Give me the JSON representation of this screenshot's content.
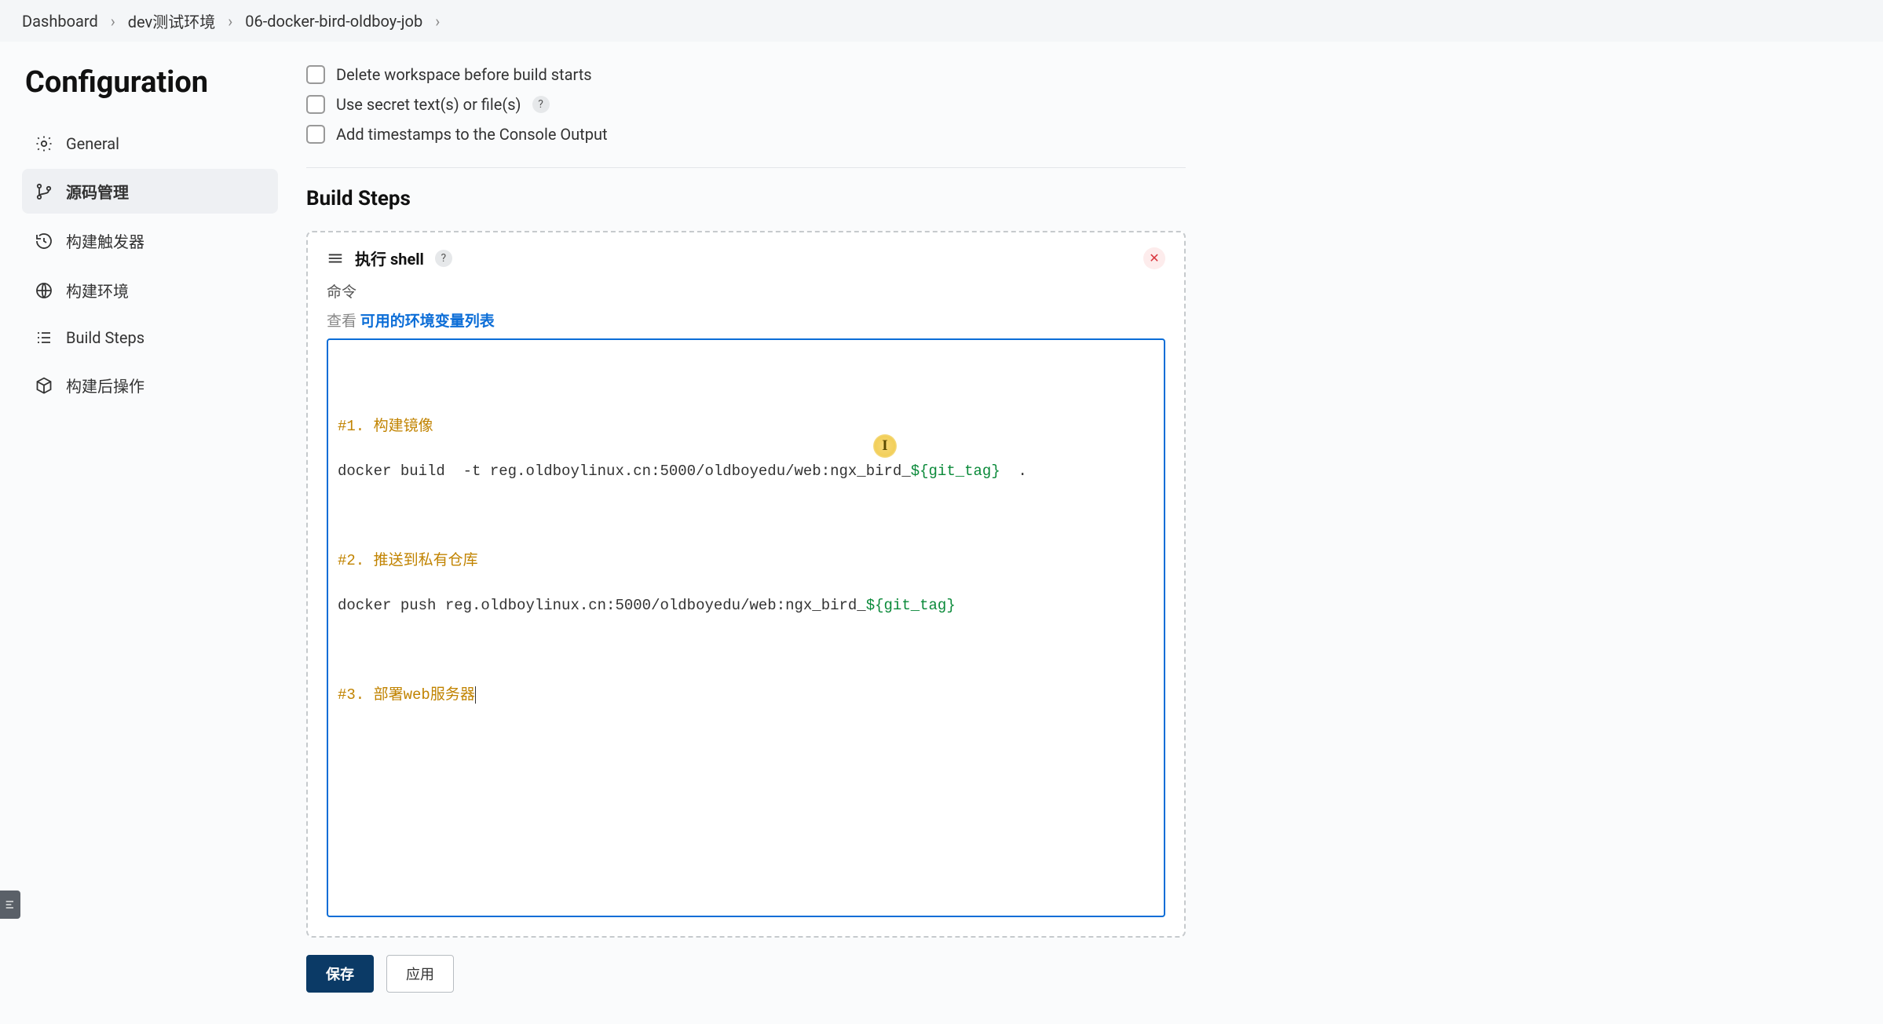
{
  "breadcrumb": {
    "items": [
      "Dashboard",
      "dev测试环境",
      "06-docker-bird-oldboy-job"
    ]
  },
  "sidebar": {
    "title": "Configuration",
    "items": [
      {
        "label": "General"
      },
      {
        "label": "源码管理"
      },
      {
        "label": "构建触发器"
      },
      {
        "label": "构建环境"
      },
      {
        "label": "Build Steps"
      },
      {
        "label": "构建后操作"
      }
    ],
    "active_index": 1
  },
  "main": {
    "checkboxes": {
      "delete_workspace": "Delete workspace before build starts",
      "use_secret": "Use secret text(s) or file(s)",
      "add_timestamps": "Add timestamps to the Console Output"
    },
    "build_steps_title": "Build Steps",
    "step": {
      "title": "执行 shell",
      "command_label": "命令",
      "hint_prefix": "查看 ",
      "hint_link": "可用的环境变量列表",
      "code": {
        "line1_comment": "#1. 构建镜像",
        "line2_cmd": "docker build  -t reg.oldboylinux.cn:5000/oldboyedu/web:ngx_bird_",
        "line2_var": "${git_tag}",
        "line2_tail": "  .",
        "line3_comment": "#2. 推送到私有仓库",
        "line4_cmd": "docker push reg.oldboylinux.cn:5000/oldboyedu/web:ngx_bird_",
        "line4_var": "${git_tag}",
        "line5_comment": "#3. 部署web服务器"
      }
    },
    "buttons": {
      "save": "保存",
      "apply": "应用"
    }
  },
  "icons": {
    "help": "?",
    "close": "✕",
    "cursor_highlight": "I"
  }
}
